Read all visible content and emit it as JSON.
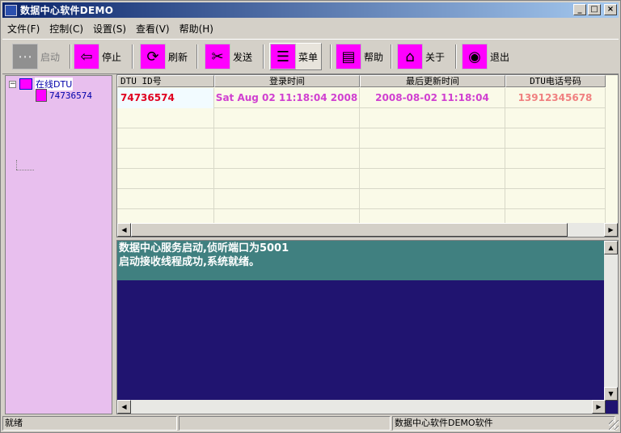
{
  "window": {
    "title": "数据中心软件DEMO",
    "buttons": [
      "_",
      "□",
      "×"
    ]
  },
  "menu": [
    "文件(F)",
    "控制(C)",
    "设置(S)",
    "查看(V)",
    "帮助(H)"
  ],
  "toolbar": [
    {
      "label": "启动",
      "icon": "start-icon",
      "glyph": "⋯",
      "disabled": true
    },
    {
      "label": "停止",
      "icon": "back-arrow-icon",
      "glyph": "⇦"
    },
    {
      "label": "刷新",
      "icon": "refresh-icon",
      "glyph": "⟳"
    },
    {
      "label": "发送",
      "icon": "scissors-icon",
      "glyph": "✂"
    },
    {
      "label": "菜单",
      "icon": "menu-icon",
      "glyph": "☰",
      "active": true
    },
    {
      "label": "帮助",
      "icon": "document-icon",
      "glyph": "▤"
    },
    {
      "label": "关于",
      "icon": "home-icon",
      "glyph": "⌂"
    },
    {
      "label": "退出",
      "icon": "disc-icon",
      "glyph": "◉"
    }
  ],
  "tree": {
    "root": "在线DTU",
    "expander": "−",
    "children": [
      "74736574"
    ]
  },
  "grid": {
    "columns": [
      "DTU ID号",
      "登录时间",
      "最后更新时间",
      "DTU电话号码"
    ],
    "rows": [
      {
        "id": "74736574",
        "login": "Sat Aug 02 11:18:04 2008",
        "updated": "2008-08-02 11:18:04",
        "phone": "13912345678"
      }
    ]
  },
  "log": [
    "数据中心服务启动,侦听端口为5001",
    "启动接收线程成功,系统就绪。"
  ],
  "scroll_arrows": {
    "left": "◀",
    "right": "▶",
    "up": "▲",
    "down": "▼"
  },
  "status": {
    "left": "就绪",
    "middle": "",
    "right": "数据中心软件DEMO软件"
  }
}
